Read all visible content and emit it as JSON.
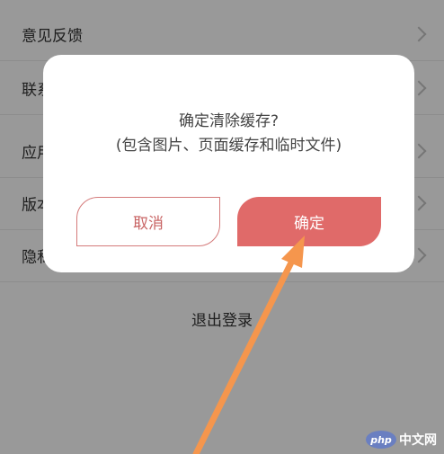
{
  "settings": {
    "items": [
      {
        "label": "意见反馈"
      },
      {
        "label": "联系"
      },
      {
        "label": "应用"
      },
      {
        "label": "版本"
      },
      {
        "label": "隐私"
      }
    ],
    "logout_label": "退出登录"
  },
  "dialog": {
    "title": "确定清除缓存?",
    "subtitle": "(包含图片、页面缓存和临时文件)",
    "cancel_label": "取消",
    "confirm_label": "确定"
  },
  "watermark": {
    "logo_text": "php",
    "site_text": "中文网"
  },
  "colors": {
    "confirm_bg": "#e06a69",
    "cancel_border": "#d47a7a",
    "annotation_arrow": "#f5964d",
    "overlay": "rgba(0,0,0,0.40)"
  }
}
